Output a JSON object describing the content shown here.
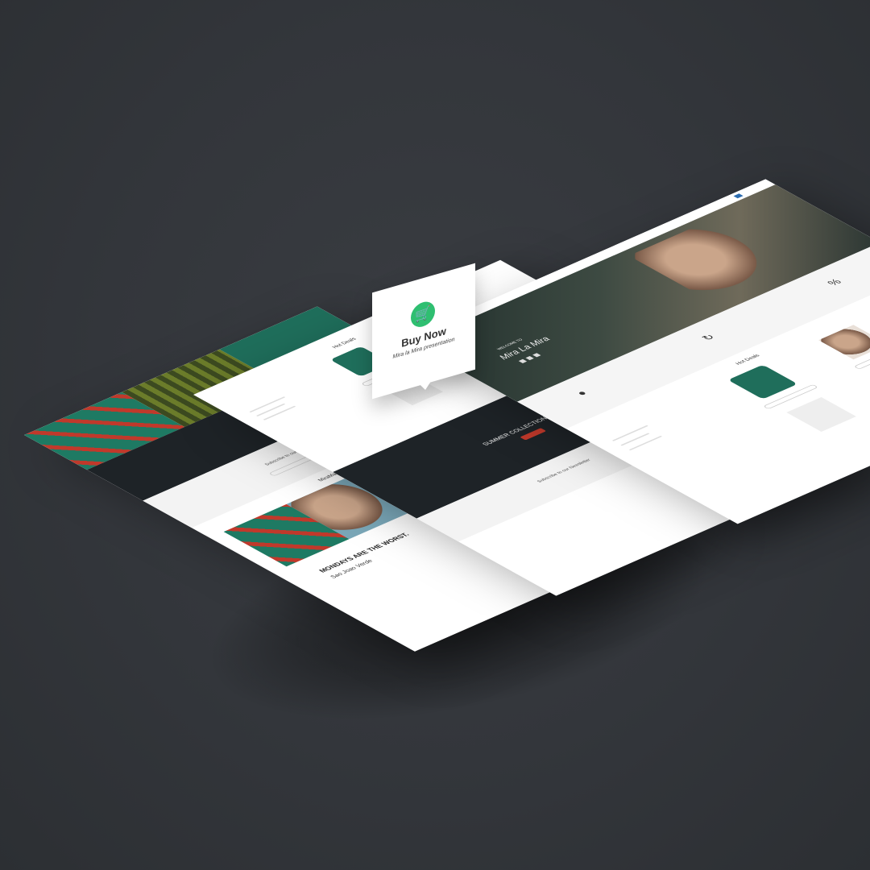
{
  "popup": {
    "icon": "shopping-cart-icon",
    "title": "Buy Now",
    "subtitle": "Mira la Mira presentation",
    "accent": "#2fbf71"
  },
  "right_screen": {
    "hero_kicker": "WELCOME TO",
    "hero_title": "Mira La Mira",
    "section_title": "Hot Deals"
  },
  "middle_screen": {
    "section_title": "Hot Deals",
    "banner_title": "SUMMER COLLECTIONS",
    "newsletter": "Subscribe to our Newsletter"
  },
  "left_screen": {
    "social_title": "MiraMaria on Social",
    "newsletter": "Subscribe to our Newsletter",
    "slogan": "MONDAYS ARE THE WORST.",
    "signature": "Sao Joao Verde"
  }
}
